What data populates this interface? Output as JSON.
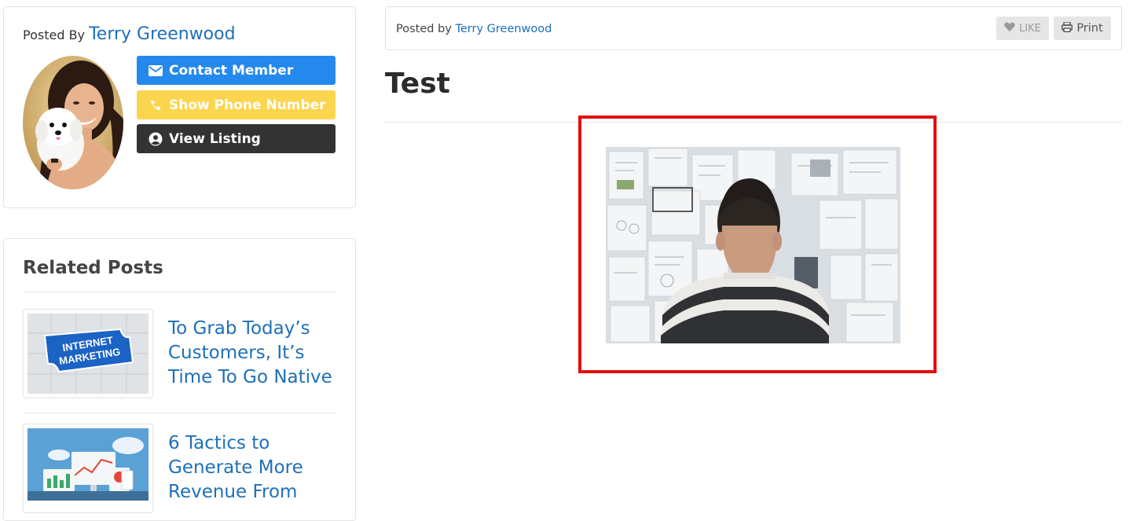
{
  "author_card": {
    "posted_by_label": "Posted By",
    "author_name": "Terry Greenwood",
    "buttons": {
      "contact": "Contact Member",
      "phone": "Show Phone Number",
      "listing": "View Listing"
    },
    "icons": {
      "contact": "envelope-icon",
      "phone": "phone-icon",
      "listing": "user-circle-icon"
    }
  },
  "related": {
    "title": "Related Posts",
    "items": [
      {
        "title": "To Grab Today’s Customers, It’s Time To Go Native",
        "thumb_text_1": "INTERNET",
        "thumb_text_2": "MARKETING"
      },
      {
        "title": "6 Tactics to Generate More Revenue From"
      }
    ]
  },
  "post": {
    "posted_by_label": "Posted by",
    "author_name": "Terry Greenwood",
    "like_label": "LIKE",
    "print_label": "Print",
    "title": "Test"
  },
  "colors": {
    "link": "#1f6fb9",
    "contact_button": "#2488ec",
    "phone_button": "#fbd54e",
    "listing_button": "#333333",
    "highlight": "#e01010"
  }
}
